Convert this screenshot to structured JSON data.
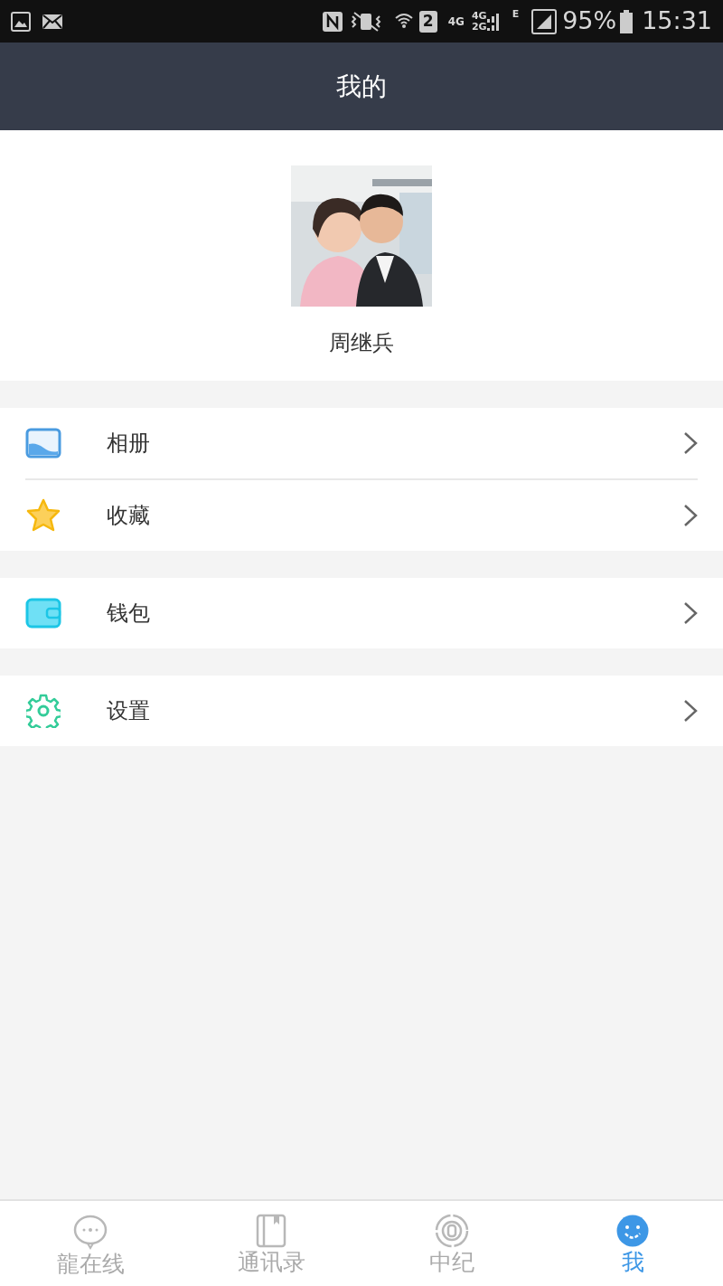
{
  "status_bar": {
    "sim": "2",
    "network_1": "4G",
    "network_2a": "4G",
    "network_2b": "2G",
    "network_3": "E",
    "battery": "95%",
    "time": "15:31"
  },
  "header": {
    "title": "我的"
  },
  "profile": {
    "name": "周继兵"
  },
  "menu_groups": [
    {
      "items": [
        {
          "kind": "album",
          "label": "相册"
        },
        {
          "kind": "star",
          "label": "收藏"
        }
      ]
    },
    {
      "items": [
        {
          "kind": "wallet",
          "label": "钱包"
        }
      ]
    },
    {
      "items": [
        {
          "kind": "gear",
          "label": "设置"
        }
      ]
    }
  ],
  "tabs": [
    {
      "kind": "chat",
      "label": "龍在线",
      "selected": false
    },
    {
      "kind": "book",
      "label": "通讯录",
      "selected": false
    },
    {
      "kind": "disc",
      "label": "中纪",
      "selected": false
    },
    {
      "kind": "face",
      "label": "我",
      "selected": true
    }
  ]
}
